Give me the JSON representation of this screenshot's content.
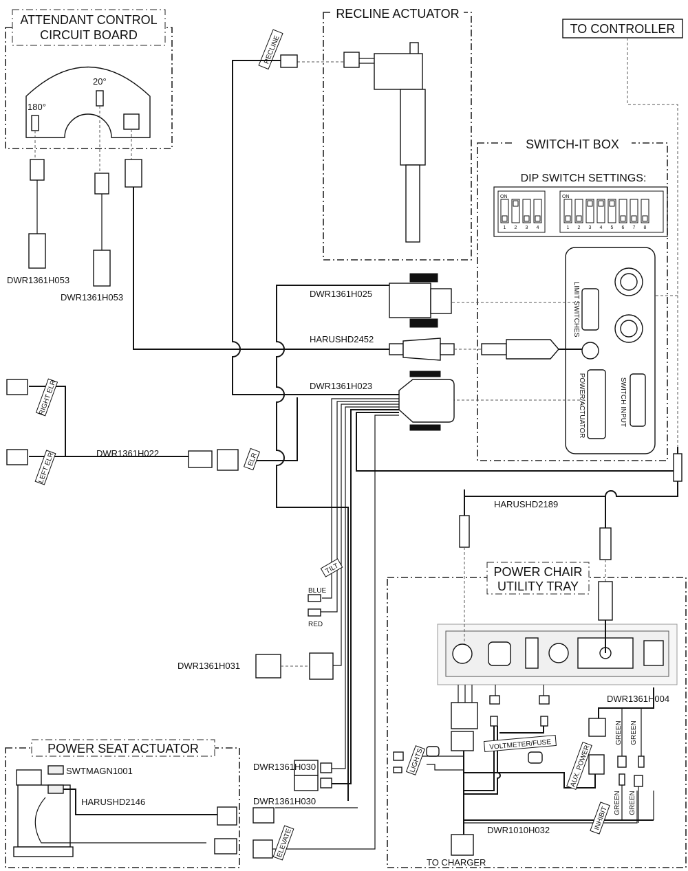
{
  "boxes": {
    "attendant_line1": "ATTENDANT CONTROL",
    "attendant_line2": "CIRCUIT BOARD",
    "recline_actuator": "RECLINE ACTUATOR",
    "to_controller": "TO CONTROLLER",
    "switch_it_box": "SWITCH-IT BOX",
    "utility_tray_line1": "POWER CHAIR",
    "utility_tray_line2": "UTILITY TRAY",
    "power_seat_actuator": "POWER SEAT ACTUATOR"
  },
  "board": {
    "angle_180": "180°",
    "angle_20": "20°"
  },
  "dip": {
    "title": "DIP SWITCH SETTINGS:",
    "on_label": "ON",
    "bank1_on": [
      false,
      true,
      false,
      false
    ],
    "bank1_numbers": [
      "1",
      "2",
      "3",
      "4"
    ],
    "bank2_on": [
      false,
      false,
      true,
      true,
      true,
      false,
      false,
      false
    ],
    "bank2_numbers": [
      "1",
      "2",
      "3",
      "4",
      "5",
      "6",
      "7",
      "8"
    ]
  },
  "ports": {
    "limit_switches": "LIMIT SWITCHES",
    "power_actuator": "POWER/ACTUATOR",
    "switch_input": "SWITCH INPUT"
  },
  "parts": {
    "dwr1361h053_a": "DWR1361H053",
    "dwr1361h053_b": "DWR1361H053",
    "dwr1361h025": "DWR1361H025",
    "harushd2452": "HARUSHD2452",
    "dwr1361h023": "DWR1361H023",
    "dwr1361h022": "DWR1361H022",
    "harushd2189": "HARUSHD2189",
    "dwr1361h031": "DWR1361H031",
    "dwr1361h030_a": "DWR1361H030",
    "dwr1361h030_b": "DWR1361H030",
    "dwr1361h004": "DWR1361H004",
    "dwr1010h032": "DWR1010H032",
    "swtmagn1001": "SWTMAGN1001",
    "harushd2146": "HARUSHD2146"
  },
  "tags": {
    "recline": "RECLINE",
    "right_elr": "RIGHT ELR",
    "left_elr": "LEFT ELR",
    "elr": "ELR",
    "tilt": "TILT",
    "blue": "BLUE",
    "red": "RED",
    "lights": "LIGHTS",
    "voltmeter_fuse": "VOLTMETER/FUSE",
    "aux_power": "AUX. POWER",
    "inhibit": "INHIBIT",
    "green": "GREEN",
    "elevate": "ELEVATE",
    "to_charger": "TO CHARGER"
  }
}
